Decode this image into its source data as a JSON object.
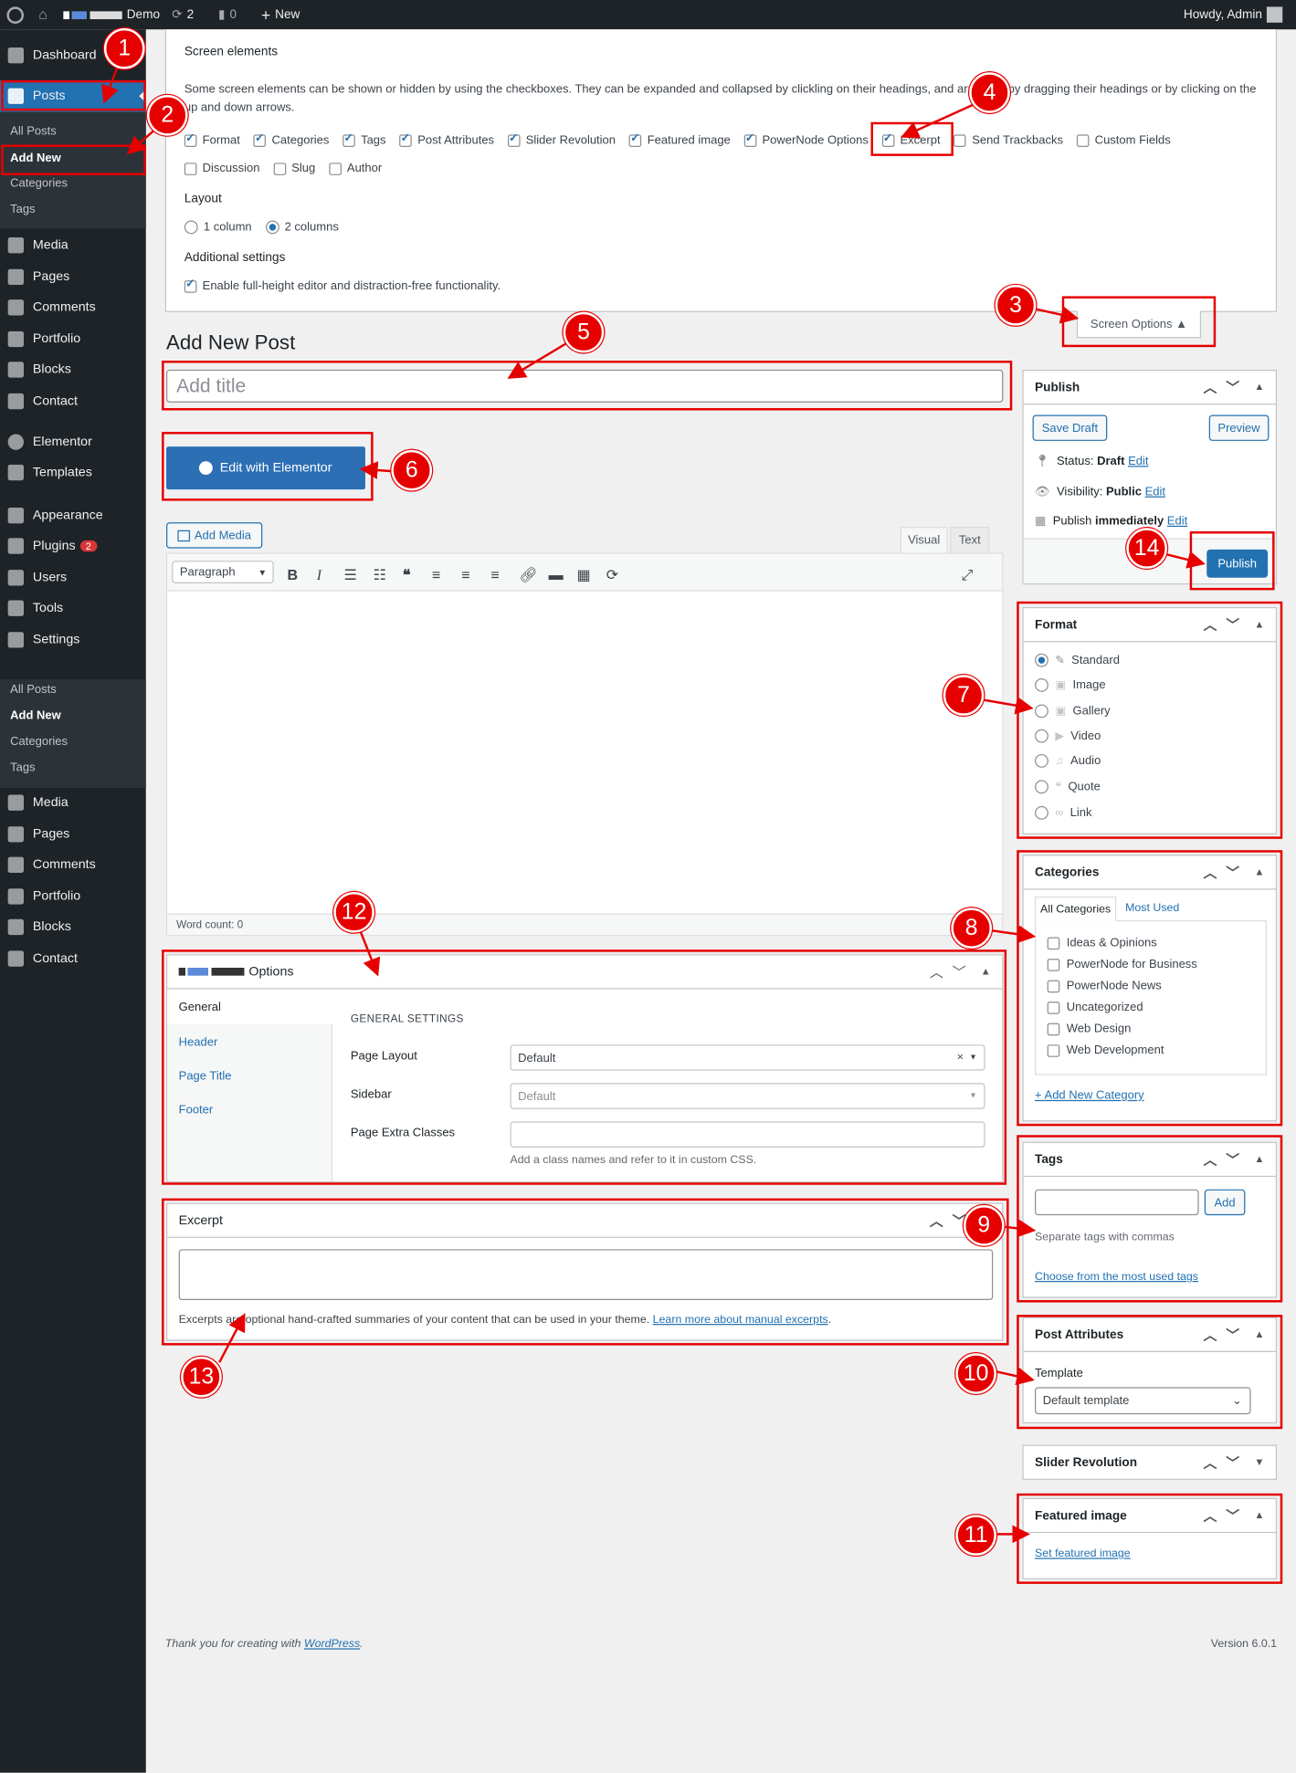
{
  "adminbar": {
    "site": "Demo",
    "updates": "2",
    "comments": "0",
    "new": "New",
    "howdy": "Howdy, Admin"
  },
  "sidebar": {
    "items_top": [
      "Dashboard",
      "Posts"
    ],
    "posts_sub": [
      "All Posts",
      "Add New",
      "Categories",
      "Tags"
    ],
    "items_mid": [
      "Media",
      "Pages",
      "Comments",
      "Portfolio",
      "Blocks",
      "Contact",
      "Elementor",
      "Templates",
      "Appearance",
      "Plugins",
      "Users",
      "Tools",
      "Settings"
    ],
    "plugins_badge": "2",
    "posts_sub2": [
      "All Posts",
      "Add New",
      "Categories",
      "Tags"
    ],
    "items_bottom": [
      "Media",
      "Pages",
      "Comments",
      "Portfolio",
      "Blocks",
      "Contact"
    ]
  },
  "screen_options": {
    "title": "Screen elements",
    "desc": "Some screen elements can be shown or hidden by using the checkboxes. They can be expanded and collapsed by clickling on their headings, and arranged by dragging their headings or by clicking on the up and down arrows.",
    "row1": [
      "Format",
      "Categories",
      "Tags",
      "Post Attributes",
      "Slider Revolution",
      "Featured image",
      "PowerNode Options",
      "Excerpt",
      "Send Trackbacks",
      "Custom Fields"
    ],
    "row2": [
      "Discussion",
      "Slug",
      "Author"
    ],
    "layout_title": "Layout",
    "layout_1": "1 column",
    "layout_2": "2 columns",
    "additional_title": "Additional settings",
    "additional_opt": "Enable full-height editor and distraction-free functionality.",
    "button": "Screen Options ▲"
  },
  "page_title": "Add New Post",
  "title_placeholder": "Add title",
  "elementor_button": "Edit with Elementor",
  "add_media": "Add Media",
  "editor_tabs": [
    "Visual",
    "Text"
  ],
  "paragraph_select": "Paragraph",
  "word_count": "Word count: 0",
  "options_box": {
    "title": "Options",
    "tabs": [
      "General",
      "Header",
      "Page Title",
      "Footer"
    ],
    "section": "GENERAL SETTINGS",
    "page_layout_label": "Page Layout",
    "page_layout_value": "Default",
    "sidebar_label": "Sidebar",
    "sidebar_value": "Default",
    "extra_label": "Page Extra Classes",
    "extra_help": "Add a class names and refer to it in custom CSS."
  },
  "excerpt_box": {
    "title": "Excerpt",
    "help": "Excerpts are optional hand-crafted summaries of your content that can be used in your theme.",
    "help_link": "Learn more about manual excerpts"
  },
  "publish_box": {
    "title": "Publish",
    "save_draft": "Save Draft",
    "preview": "Preview",
    "status_label": "Status: ",
    "status_value": "Draft",
    "visibility_label": "Visibility: ",
    "visibility_value": "Public",
    "publish_label": "Publish ",
    "publish_value": "immediately",
    "edit": "Edit",
    "publish_button": "Publish"
  },
  "format_box": {
    "title": "Format",
    "options": [
      "Standard",
      "Image",
      "Gallery",
      "Video",
      "Audio",
      "Quote",
      "Link"
    ]
  },
  "categories_box": {
    "title": "Categories",
    "tab_all": "All Categories",
    "tab_used": "Most Used",
    "items": [
      "Ideas & Opinions",
      "PowerNode for Business",
      "PowerNode News",
      "Uncategorized",
      "Web Design",
      "Web Development"
    ],
    "add_new": "+ Add New Category"
  },
  "tags_box": {
    "title": "Tags",
    "add": "Add",
    "help": "Separate tags with commas",
    "choose": "Choose from the most used tags"
  },
  "post_attributes_box": {
    "title": "Post Attributes",
    "template_label": "Template",
    "template_value": "Default template"
  },
  "slider_box": {
    "title": "Slider Revolution"
  },
  "featured_box": {
    "title": "Featured image",
    "link": "Set featured image"
  },
  "footer": {
    "thanks": "Thank you for creating with ",
    "wp": "WordPress",
    "period": ".",
    "version": "Version 6.0.1"
  },
  "badges": [
    "1",
    "2",
    "3",
    "4",
    "5",
    "6",
    "7",
    "8",
    "9",
    "10",
    "11",
    "12",
    "13",
    "14"
  ],
  "colors": {
    "highlight": "#e60000",
    "wp_blue": "#2271b1",
    "admin_dark": "#1d2327"
  }
}
